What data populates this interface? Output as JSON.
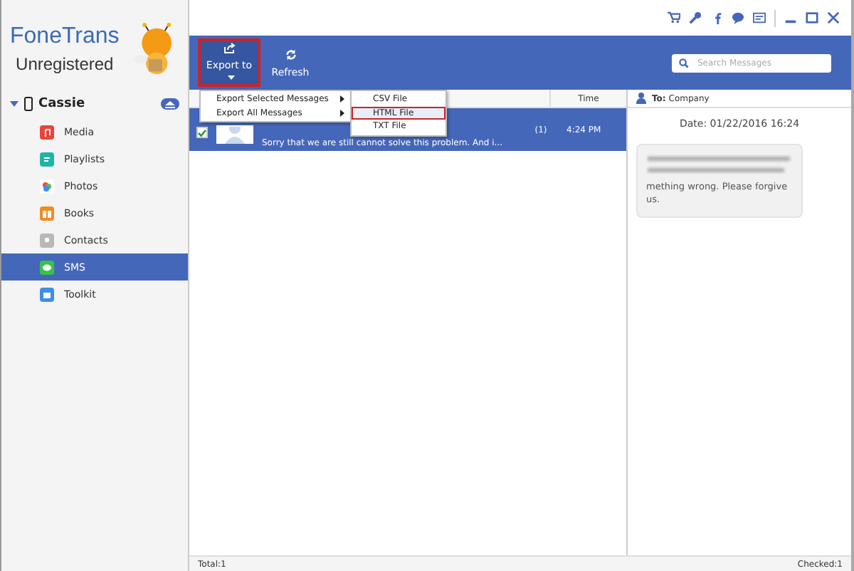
{
  "app": {
    "name": "FoneTrans",
    "status": "Unregistered"
  },
  "device": {
    "name": "Cassie",
    "expanded": true
  },
  "sidebar": {
    "items": [
      {
        "label": "Media",
        "selected": false
      },
      {
        "label": "Playlists",
        "selected": false
      },
      {
        "label": "Photos",
        "selected": false
      },
      {
        "label": "Books",
        "selected": false
      },
      {
        "label": "Contacts",
        "selected": false
      },
      {
        "label": "SMS",
        "selected": true
      },
      {
        "label": "Toolkit",
        "selected": false
      }
    ]
  },
  "toolbar": {
    "buttons": [
      {
        "label": "Export to",
        "kind": "dropdown",
        "selected": true
      },
      {
        "label": "Refresh",
        "kind": "plain",
        "selected": false
      }
    ]
  },
  "search": {
    "placeholder": "Search Messages"
  },
  "export_menu": {
    "items": [
      {
        "label": "Export Selected Messages",
        "selected": false
      },
      {
        "label": "Export All Messages",
        "selected": false
      }
    ]
  },
  "format_menu": {
    "items": [
      {
        "label": "CSV File",
        "selected": false
      },
      {
        "label": "HTML File",
        "selected": true
      },
      {
        "label": "TXT File",
        "selected": false
      }
    ]
  },
  "message_list": {
    "columns": [
      "Time"
    ],
    "rows": [
      {
        "checked": true,
        "selected": true,
        "preview": "Sorry that we are still cannot solve this problem. And i...",
        "count": "(1)",
        "time": "4:24 PM"
      }
    ]
  },
  "conversation": {
    "recipient_label": "To:",
    "recipient": "Company",
    "date": "Date: 01/22/2016 16:24",
    "messages": [
      {
        "text": "mething wrong. Please forgive us."
      }
    ]
  },
  "status_bar": {
    "total": "Total:1",
    "checked": "Checked:1"
  }
}
